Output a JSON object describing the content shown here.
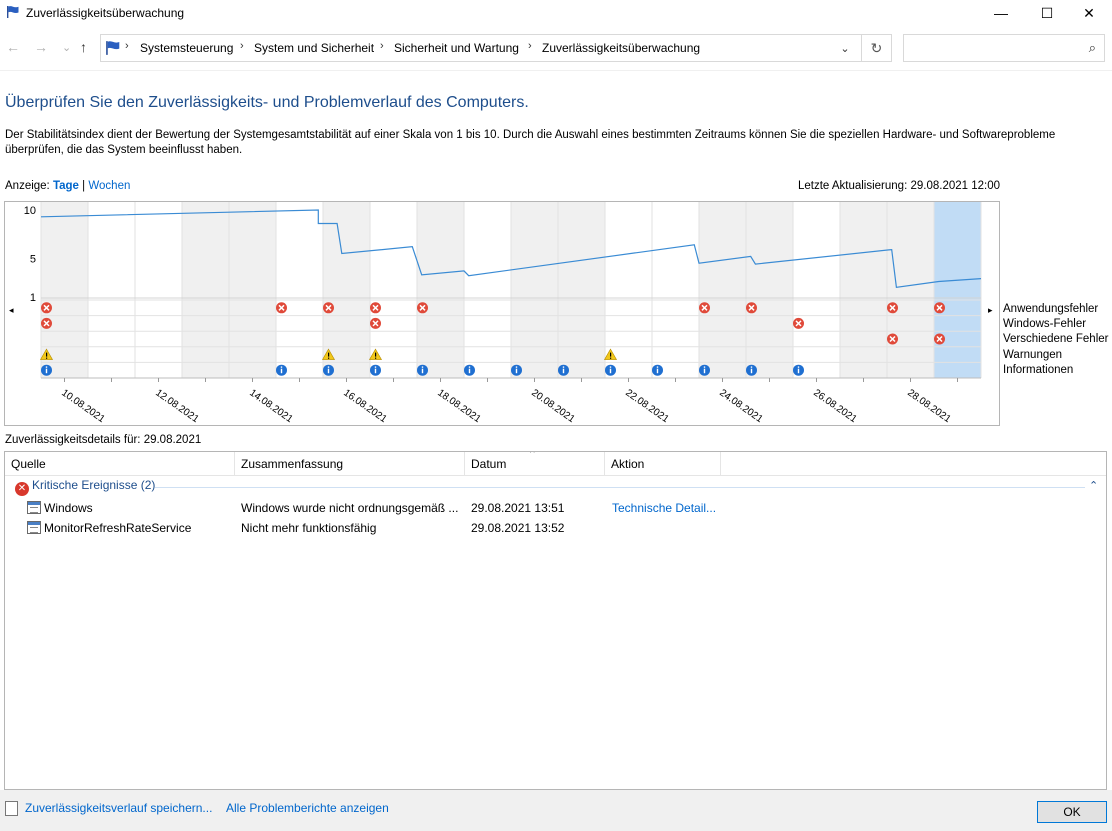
{
  "window": {
    "title": "Zuverlässigkeitsüberwachung",
    "minimize": "—",
    "maximize": "☐",
    "close": "✕"
  },
  "nav": {
    "back": "←",
    "forward": "→",
    "recent": "⌄",
    "up": "↑",
    "breadcrumbs": [
      "Systemsteuerung",
      "System und Sicherheit",
      "Sicherheit und Wartung",
      "Zuverlässigkeitsüberwachung"
    ],
    "separator": "›",
    "dropdown": "⌄",
    "refresh": "↻",
    "search_placeholder": "",
    "search_icon": "⌕"
  },
  "heading": "Überprüfen Sie den Zuverlässigkeits- und Problemverlauf des Computers.",
  "description": "Der Stabilitätsindex dient der Bewertung der Systemgesamtstabilität auf einer Skala von 1 bis 10. Durch die Auswahl eines bestimmten Zeitraums können Sie die speziellen Hardware- und Softwareprobleme überprüfen, die das System beeinflusst haben.",
  "view": {
    "label": "Anzeige:",
    "days": "Tage",
    "sep": "|",
    "weeks": "Wochen",
    "last_update": "Letzte Aktualisierung: 29.08.2021 12:00"
  },
  "chart_data": {
    "type": "line",
    "ylim": [
      1,
      10
    ],
    "yticks": [
      "10",
      "5",
      "1"
    ],
    "columns": 20,
    "selected_column": 19,
    "shaded_columns": [
      0,
      3,
      4,
      6,
      8,
      10,
      11,
      14,
      15,
      17,
      18
    ],
    "date_labels": [
      "10.08.2021",
      "12.08.2021",
      "14.08.2021",
      "16.08.2021",
      "18.08.2021",
      "20.08.2021",
      "22.08.2021",
      "24.08.2021",
      "26.08.2021",
      "28.08.2021"
    ],
    "stability": [
      [
        0,
        9.3
      ],
      [
        5.9,
        10.0
      ],
      [
        5.9,
        8.6
      ],
      [
        6.3,
        8.6
      ],
      [
        6.4,
        5.5
      ],
      [
        7.9,
        6.2
      ],
      [
        8.1,
        3.3
      ],
      [
        9.0,
        3.7
      ],
      [
        9.1,
        3.2
      ],
      [
        13.9,
        6.4
      ],
      [
        14.0,
        4.5
      ],
      [
        15.1,
        5.2
      ],
      [
        15.2,
        4.4
      ],
      [
        18.1,
        5.9
      ],
      [
        18.2,
        2.0
      ],
      [
        19.1,
        2.6
      ],
      [
        20,
        2.9
      ]
    ],
    "rows": [
      "Anwendungsfehler",
      "Windows-Fehler",
      "Verschiedene Fehler",
      "Warnungen",
      "Informationen"
    ],
    "events": {
      "Anwendungsfehler": [
        0,
        5,
        6,
        7,
        8,
        14,
        15,
        18,
        19
      ],
      "Windows-Fehler": [
        0,
        7,
        16
      ],
      "Verschiedene Fehler": [
        18,
        19
      ],
      "Warnungen": [
        0,
        6,
        7,
        12
      ],
      "Informationen": [
        0,
        5,
        6,
        7,
        8,
        9,
        10,
        11,
        12,
        13,
        14,
        15,
        16
      ]
    },
    "colors": {
      "line": "#3a8bd4",
      "shade": "#f0f0f0",
      "selected": "#c1dcf5",
      "error": "#e04a3a",
      "warning": "#f2c81a",
      "info": "#1f6fd1"
    }
  },
  "chart_nav": {
    "left": "◂",
    "right": "▸"
  },
  "details_for": "Zuverlässigkeitsdetails für: 29.08.2021",
  "table": {
    "columns": [
      "Quelle",
      "Zusammenfassung",
      "Datum",
      "Aktion"
    ],
    "sort_caret": "^",
    "group": {
      "icon": "✕",
      "label": "Kritische Ereignisse (2)",
      "collapse": "⌃"
    },
    "rows": [
      {
        "source": "Windows",
        "summary": "Windows wurde nicht ordnungsgemäß ...",
        "date": "29.08.2021 13:51",
        "action": "Technische Detail..."
      },
      {
        "source": "MonitorRefreshRateService",
        "summary": "Nicht mehr funktionsfähig",
        "date": "29.08.2021 13:52",
        "action": ""
      }
    ]
  },
  "footer": {
    "save_history": "Zuverlässigkeitsverlauf speichern...",
    "all_reports": "Alle Problemberichte anzeigen",
    "ok": "OK"
  }
}
